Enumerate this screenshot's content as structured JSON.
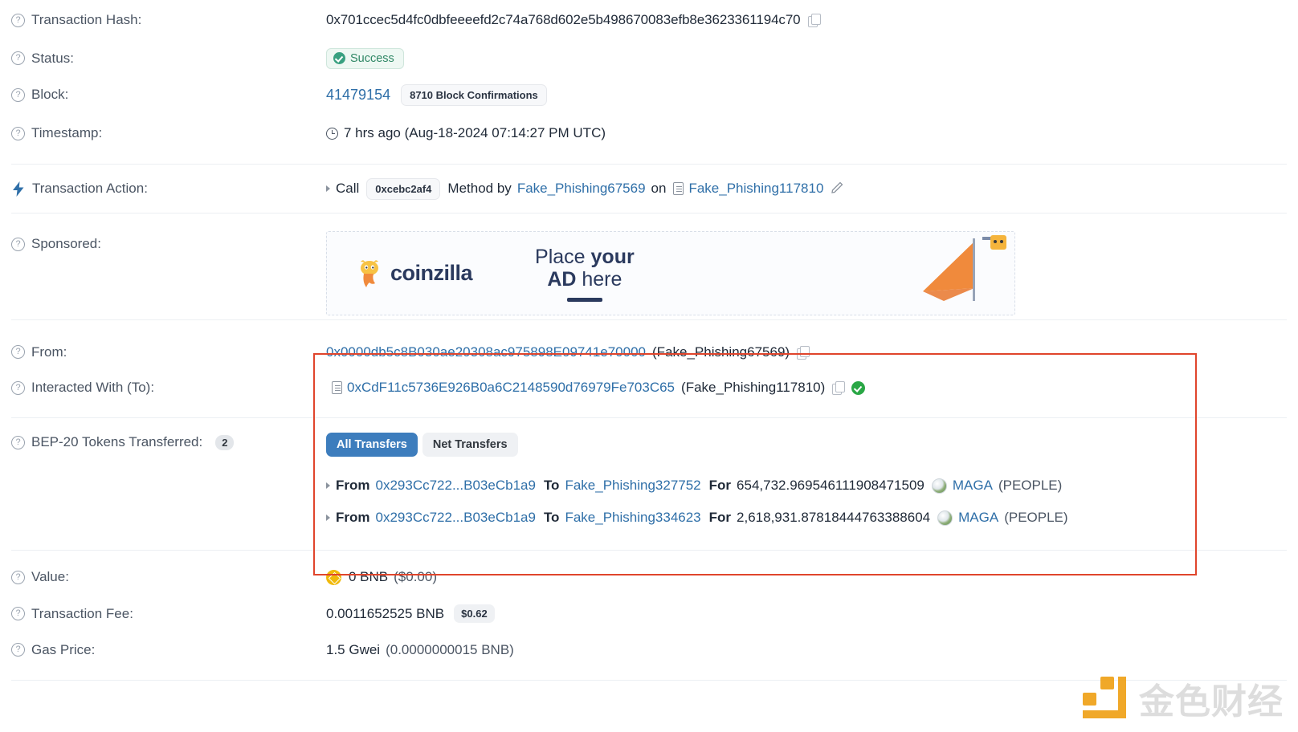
{
  "rows": {
    "tx_hash": {
      "label": "Transaction Hash:",
      "value": "0x701ccec5d4fc0dbfeeeefd2c74a768d602e5b498670083efb8e3623361194c70",
      "copy_icon": "copy-icon"
    },
    "status": {
      "label": "Status:",
      "badge": "Success",
      "badge_color": "#2f8765",
      "badge_bg": "#eef8f3"
    },
    "block": {
      "label": "Block:",
      "number": "41479154",
      "confirmations": "8710 Block Confirmations"
    },
    "timestamp": {
      "label": "Timestamp:",
      "value": "7 hrs ago (Aug-18-2024 07:14:27 PM UTC)",
      "clock_icon": "clock-icon"
    },
    "action": {
      "label": "Transaction Action:",
      "bolt_icon": "lightning-icon",
      "call_word": "Call",
      "method_sig": "0xcebc2af4",
      "method_by": "Method by",
      "caller": "Fake_Phishing67569",
      "on_word": "on",
      "contract": "Fake_Phishing117810",
      "edit_icon": "pencil-icon"
    },
    "sponsored": {
      "label": "Sponsored:",
      "brand": "coinzilla",
      "line1_a": "Place ",
      "line1_b": "your",
      "line2_a": "AD ",
      "line2_b": "here"
    },
    "from": {
      "label": "From:",
      "address": "0x0000db5c8B030ae20308ac975898E09741e70000",
      "tag": "(Fake_Phishing67569)"
    },
    "to": {
      "label": "Interacted With (To):",
      "address": "0xCdF11c5736E926B0a6C2148590d76979Fe703C65",
      "tag": "(Fake_Phishing117810)",
      "verified_icon": "verified-check-icon"
    },
    "tokens": {
      "label": "BEP-20 Tokens Transferred:",
      "count": "2",
      "tabs": [
        {
          "label": "All Transfers",
          "active": true
        },
        {
          "label": "Net Transfers",
          "active": false
        }
      ],
      "transfers": [
        {
          "from_word": "From",
          "from_addr": "0x293Cc722...B03eCb1a9",
          "to_word": "To",
          "to_addr": "Fake_Phishing327752",
          "for_word": "For",
          "amount": "654,732.969546111908471509",
          "token_symbol": "MAGA",
          "token_name": "(PEOPLE)"
        },
        {
          "from_word": "From",
          "from_addr": "0x293Cc722...B03eCb1a9",
          "to_word": "To",
          "to_addr": "Fake_Phishing334623",
          "for_word": "For",
          "amount": "2,618,931.87818444763388604",
          "token_symbol": "MAGA",
          "token_name": "(PEOPLE)"
        }
      ]
    },
    "value": {
      "label": "Value:",
      "amount": "0 BNB",
      "fiat": "($0.00)",
      "coin_icon": "bnb-coin-icon"
    },
    "fee": {
      "label": "Transaction Fee:",
      "amount": "0.0011652525 BNB",
      "fiat_badge": "$0.62"
    },
    "gas": {
      "label": "Gas Price:",
      "amount": "1.5 Gwei",
      "detail": "(0.0000000015 BNB)"
    }
  },
  "watermark": {
    "text_a": "金色财",
    "text_b": "经"
  },
  "colors": {
    "link": "#2f6fa8",
    "highlight_border": "#e0452c",
    "tab_active_bg": "#3d7dbd",
    "bnb_yellow": "#f0b90b",
    "watermark_orange": "#f0a41e"
  }
}
